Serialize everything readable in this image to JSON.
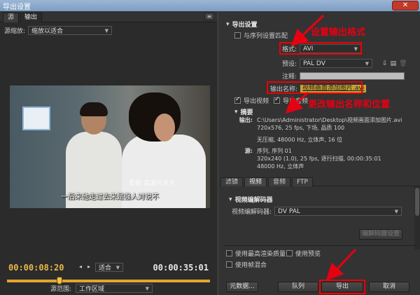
{
  "window": {
    "title": "导出设置"
  },
  "left_panel": {
    "tabs": [
      "源",
      "输出"
    ],
    "panel_menu": "≡",
    "source_scale_label": "源缩放:",
    "source_scale_value": "缩放以适合",
    "subtitle": "一后来他走过去来是强人对说不",
    "watermark": "影视 高清片点卡",
    "timecode_current": "00:00:08:20",
    "timecode_total": "00:00:35:01",
    "fit_value": "适合",
    "source_range_label": "源范围:",
    "source_range_value": "工作区域",
    "scrub_fraction": 0.25
  },
  "export_settings": {
    "section_title": "导出设置",
    "match_sequence_label": "与序列设置匹配",
    "format_label": "格式:",
    "format_value": "AVI",
    "preset_label": "预设:",
    "preset_value": "PAL DV",
    "comment_label": "注释:",
    "output_name_label": "输出名称:",
    "output_name_value": "视频画面添加图片.avi",
    "export_video_label": "导出视频",
    "export_audio_label": "导出音频"
  },
  "summary": {
    "title": "摘要",
    "output_key": "输出:",
    "output_lines": [
      "C:\\Users\\Administrator\\Desktop\\视频画面添加图片.avi",
      "720x576, 25 fps, 下场, 品质 100",
      "",
      "无压缩, 48000 Hz, 立体声, 16 位"
    ],
    "source_key": "源:",
    "source_lines": [
      "序列, 序列 01",
      "320x240 (1.0), 25 fps, 逐行扫描, 00:00:35:01",
      "48000 Hz, 立体声"
    ]
  },
  "settings_tabs": [
    "滤镜",
    "视频",
    "音频",
    "FTP"
  ],
  "video_codec": {
    "section_title": "视频编解码器",
    "codec_label": "视频编解码器:",
    "codec_value": "DV PAL",
    "codec_settings_button": "编解码器设置"
  },
  "options": {
    "max_render_quality": "使用最高渲染质量",
    "use_previews": "使用预览",
    "frame_blending": "使用帧混合"
  },
  "buttons": {
    "metadata": "元数据...",
    "queue": "队列",
    "export": "导出",
    "cancel": "取消"
  },
  "annotations": {
    "format_note": "设置输出格式",
    "name_note": "更改输出名称和位置"
  },
  "colors": {
    "annotation": "#e60012",
    "timecode": "#e8b84a",
    "scrub": "#e3a62b"
  }
}
